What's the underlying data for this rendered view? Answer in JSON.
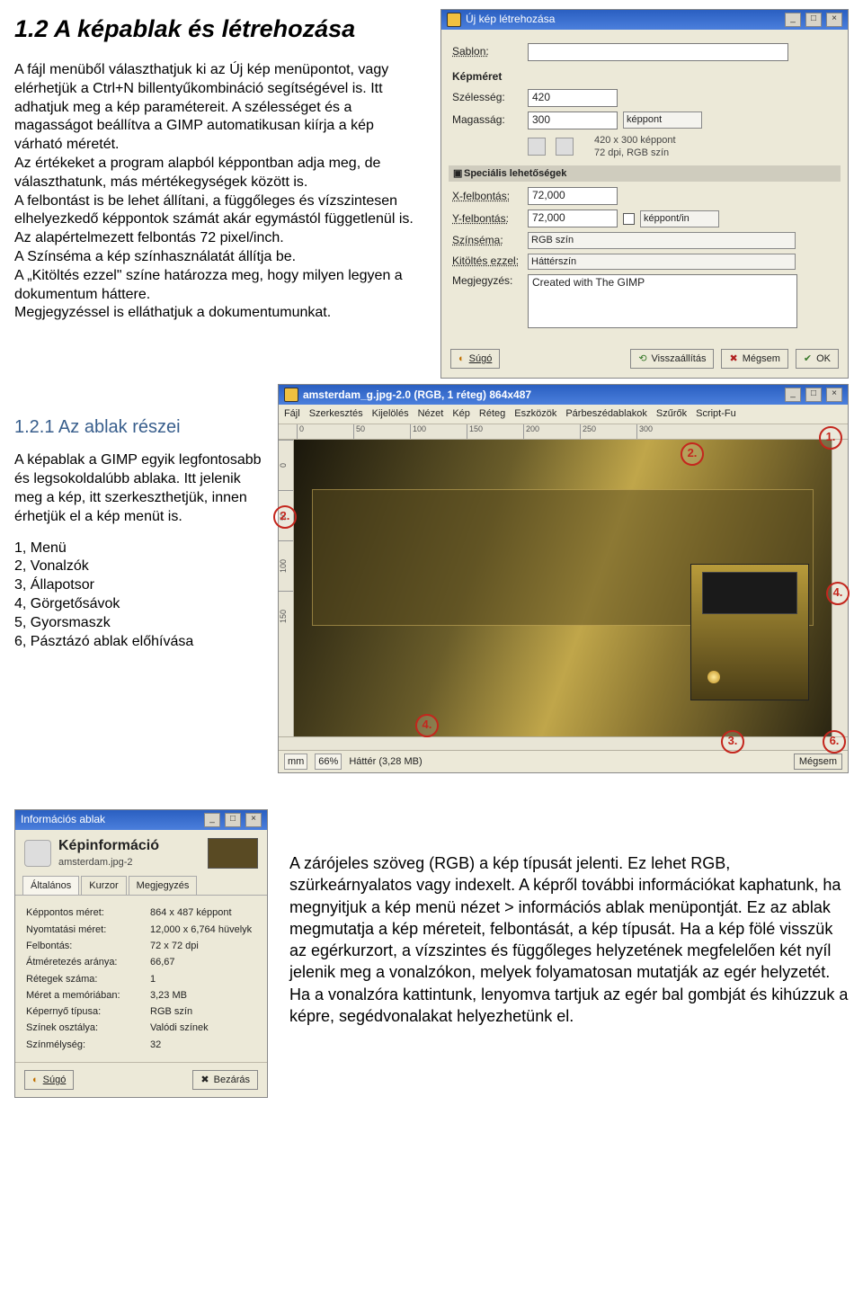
{
  "section1": {
    "heading": "1.2 A képablak és létrehozása",
    "para": "A fájl menüből választhatjuk ki az Új kép menüpontot, vagy elérhetjük a Ctrl+N billentyűkombináció segítségével is. Itt adhatjuk meg a kép paramétereit. A szélességet és a magasságot beállítva a GIMP automatikusan kiírja a kép várható méretét.\nAz értékeket a program alapból képpontban adja meg, de választhatunk, más mértékegységek között is.\nA felbontást is be lehet állítani, a függőleges és vízszintesen elhelyezkedő képpontok számát akár egymástól függetlenül is. Az alapértelmezett felbontás 72 pixel/inch.\nA Színséma a kép színhasználatát állítja be.\nA „Kitöltés ezzel\" színe határozza meg, hogy milyen legyen a dokumentum háttere.\nMegjegyzéssel is elláthatjuk a dokumentumunkat."
  },
  "dlg": {
    "title": "Új kép létrehozása",
    "sablon_lbl": "Sablon:",
    "kepmeret": "Képméret",
    "szelesseg_lbl": "Szélesség:",
    "szelesseg": "420",
    "magassag_lbl": "Magasság:",
    "magassag": "300",
    "unit": "képpont",
    "size_info": "420 x 300 képpont\n72 dpi, RGB szín",
    "spec": "Speciális lehetőségek",
    "xfel_lbl": "X-felbontás:",
    "xfel": "72,000",
    "yfel_lbl": "Y-felbontás:",
    "yfel": "72,000",
    "res_unit": "képpont/in",
    "szinsema_lbl": "Színséma:",
    "szinsema": "RGB szín",
    "kitoltes_lbl": "Kitöltés ezzel:",
    "kitoltes": "Háttérszín",
    "megj_lbl": "Megjegyzés:",
    "megj": "Created with The GIMP",
    "b_help": "Súgó",
    "b_reset": "Visszaállítás",
    "b_cancel": "Mégsem",
    "b_ok": "OK"
  },
  "section2": {
    "heading": "1.2.1 Az ablak részei",
    "p1": "A képablak a GIMP egyik legfontosabb és legsokoldalúbb ablaka. Itt jelenik meg a kép, itt szerkeszthetjük, innen érhetjük el a kép menüt is.",
    "list": [
      "1, Menü",
      "2, Vonalzók",
      "3, Állapotsor",
      "4, Görgetősávok",
      "5, Gyorsmaszk",
      "6, Pásztázó ablak előhívása"
    ]
  },
  "imgwin": {
    "title": "amsterdam_g.jpg-2.0 (RGB, 1 réteg) 864x487",
    "menus": [
      "Fájl",
      "Szerkesztés",
      "Kijelölés",
      "Nézet",
      "Kép",
      "Réteg",
      "Eszközök",
      "Párbeszédablakok",
      "Szűrők",
      "Script-Fu"
    ],
    "ruler_h": [
      "0",
      "50",
      "100",
      "150",
      "200",
      "250",
      "300"
    ],
    "ruler_v": [
      "0",
      "50",
      "100",
      "150"
    ],
    "status_unit": "mm",
    "status_zoom": "66%",
    "status_layer": "Háttér (3,28 MB)",
    "status_cancel": "Mégsem",
    "badges": {
      "b1": "1.",
      "b2": "2.",
      "b2b": "2.",
      "b3": "3.",
      "b4": "4.",
      "b4b": "4.",
      "b6": "6."
    }
  },
  "info": {
    "title": "Információs ablak",
    "header": "Képinformáció",
    "sub": "amsterdam.jpg-2",
    "tabs": [
      "Általános",
      "Kurzor",
      "Megjegyzés"
    ],
    "rows": [
      [
        "Képpontos méret:",
        "864 x 487 képpont"
      ],
      [
        "Nyomtatási méret:",
        "12,000 x 6,764 hüvelyk"
      ],
      [
        "Felbontás:",
        "72 x 72 dpi"
      ],
      [
        "Átméretezés aránya:",
        "66,67"
      ],
      [
        "Rétegek száma:",
        "1"
      ],
      [
        "Méret a memóriában:",
        "3,23 MB"
      ],
      [
        "Képernyő típusa:",
        "RGB szín"
      ],
      [
        "Színek osztálya:",
        "Valódi színek"
      ],
      [
        "Színmélység:",
        "32"
      ]
    ],
    "b_help": "Súgó",
    "b_close": "Bezárás"
  },
  "section3": {
    "para": "A zárójeles szöveg (RGB) a kép típusát jelenti. Ez lehet RGB, szürkeárnyalatos vagy indexelt. A képről további információkat kaphatunk, ha megnyitjuk a kép menü nézet > információs ablak menüpontját. Ez az ablak megmutatja a kép méreteit, felbontását, a kép típusát. Ha a kép fölé visszük az egérkurzort, a vízszintes és függőleges helyzetének megfelelően két nyíl jelenik meg a vonalzókon, melyek folyamatosan mutatják az egér helyzetét. Ha a vonalzóra kattintunk, lenyomva tartjuk az egér bal gombját és kihúzzuk a képre, segédvonalakat helyezhetünk el."
  }
}
